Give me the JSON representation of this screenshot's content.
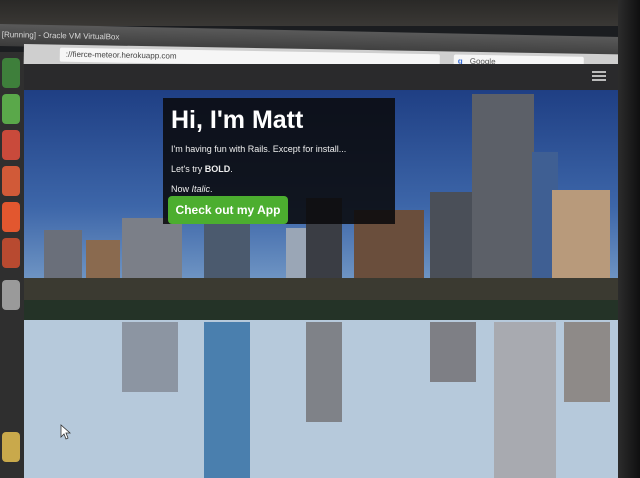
{
  "window": {
    "title": "[Running] - Oracle VM VirtualBox"
  },
  "browser": {
    "url": "://fierce-meteor.herokuapp.com",
    "search_placeholder": "Google",
    "search_icon": "google-icon"
  },
  "navbar": {
    "brand": "",
    "menu_icon": "hamburger-menu-icon"
  },
  "hero": {
    "heading": "Hi, I'm Matt",
    "line1": "I'm having fun with Rails. Except for install...",
    "line2_prefix": "Let's try ",
    "line2_bold": "BOLD",
    "line2_suffix": ".",
    "line3_prefix": "Now ",
    "line3_italic": "Italic",
    "line3_suffix": ".",
    "cta_label": "Check out my App"
  },
  "colors": {
    "cta": "#4cae2f",
    "hero_bg": "#0a0a0c",
    "sky": "#2f5aa0"
  },
  "launcher": {
    "icons": [
      "files-icon",
      "browser-icon",
      "app-icon",
      "office-icon",
      "ubuntu-one-icon",
      "settings-icon",
      "workspace-icon",
      "trash-icon"
    ]
  }
}
